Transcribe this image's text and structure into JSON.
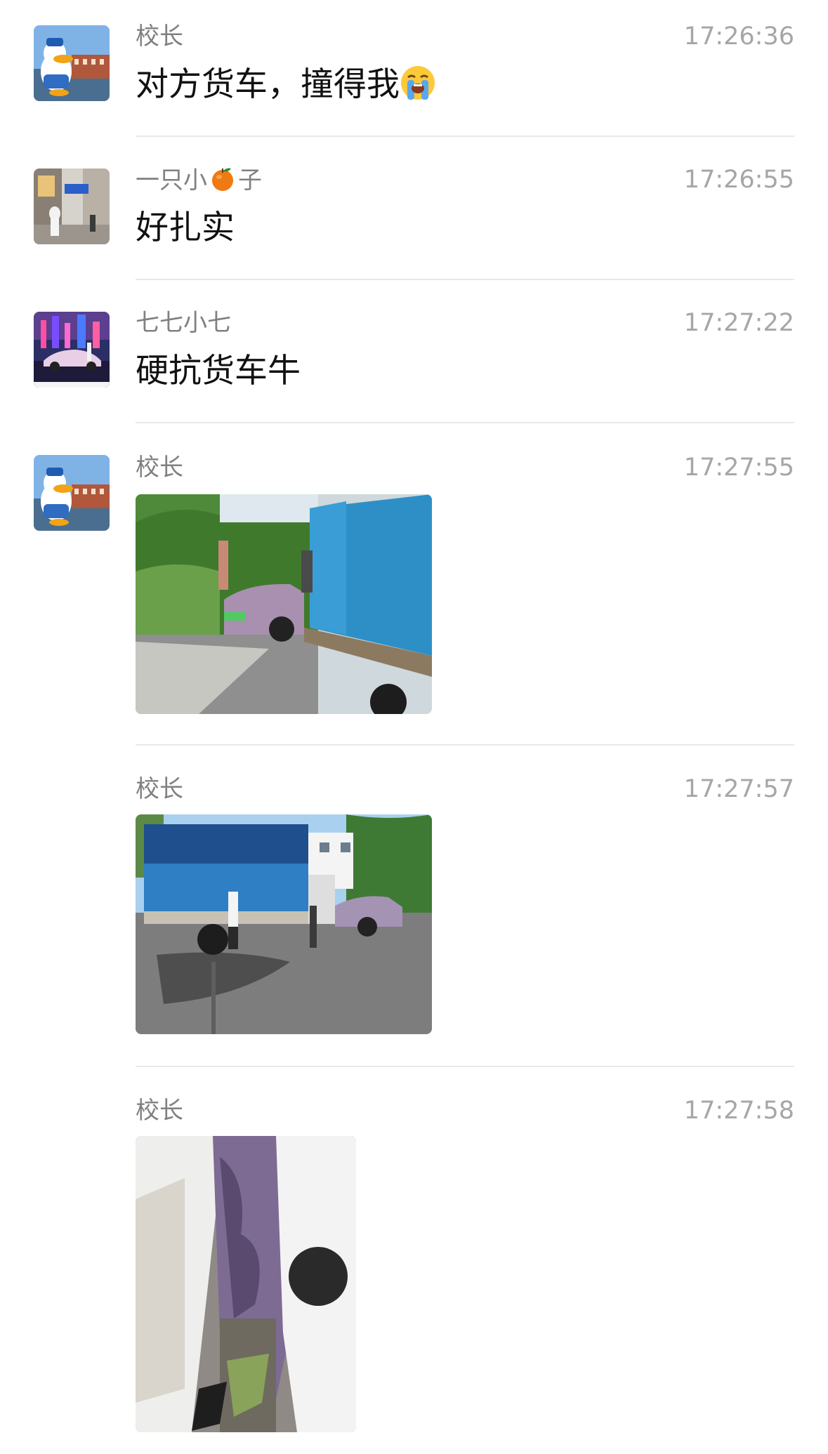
{
  "messages": [
    {
      "sender": "校长",
      "time": "17:26:36",
      "text": "对方货车，撞得我",
      "avatar_icon": "donald-duck-avatar-icon",
      "emoji_icon": "loudly-crying-face-icon"
    },
    {
      "sender_prefix": "一只小",
      "sender_suffix": "子",
      "sender_icon": "tangerine-icon",
      "time": "17:26:55",
      "text": "好扎实",
      "avatar_icon": "street-scene-avatar-icon"
    },
    {
      "sender": "七七小七",
      "time": "17:27:22",
      "text": "硬抗货车牛",
      "avatar_icon": "night-car-avatar-icon"
    },
    {
      "sender": "校长",
      "time": "17:27:55",
      "image_icon": "truck-crash-photo-icon",
      "avatar_icon": "donald-duck-avatar-icon"
    },
    {
      "sender": "校长",
      "time": "17:27:57",
      "image_icon": "truck-road-photo-icon"
    },
    {
      "sender": "校长",
      "time": "17:27:58",
      "image_icon": "car-door-damage-photo-icon"
    }
  ],
  "colors": {
    "sender": "#808080",
    "time": "#a6a6a6",
    "text": "#111111",
    "divider": "#e9e9e9"
  }
}
